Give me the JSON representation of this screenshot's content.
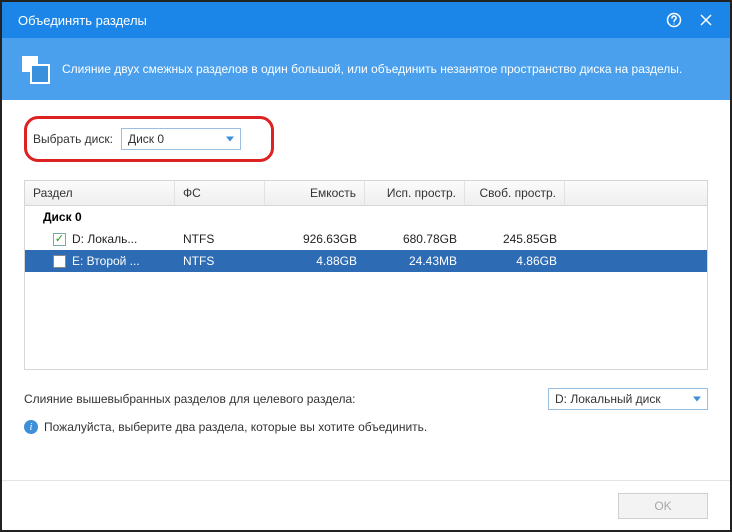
{
  "titlebar": {
    "title": "Объединять разделы"
  },
  "banner": {
    "text": "Слияние двух смежных разделов в один большой, или объединить незанятое пространство диска на разделы."
  },
  "disk_select": {
    "label": "Выбрать диск:",
    "value": "Диск 0"
  },
  "grid": {
    "headers": {
      "partition": "Раздел",
      "fs": "ФС",
      "capacity": "Емкость",
      "used": "Исп. простр.",
      "free": "Своб. простр."
    },
    "disk_label": "Диск 0",
    "rows": [
      {
        "checked": true,
        "selected": false,
        "partition": "D:  Локаль...",
        "fs": "NTFS",
        "capacity": "926.63GB",
        "used": "680.78GB",
        "free": "245.85GB"
      },
      {
        "checked": false,
        "selected": true,
        "partition": "E:  Второй ...",
        "fs": "NTFS",
        "capacity": "4.88GB",
        "used": "24.43MB",
        "free": "4.86GB"
      }
    ]
  },
  "target": {
    "label": "Слияние вышевыбранных разделов для целевого раздела:",
    "value": "D:  Локальный диск"
  },
  "hint": {
    "text": "Пожалуйста, выберите два раздела, которые вы хотите объединить."
  },
  "footer": {
    "ok": "OK"
  }
}
